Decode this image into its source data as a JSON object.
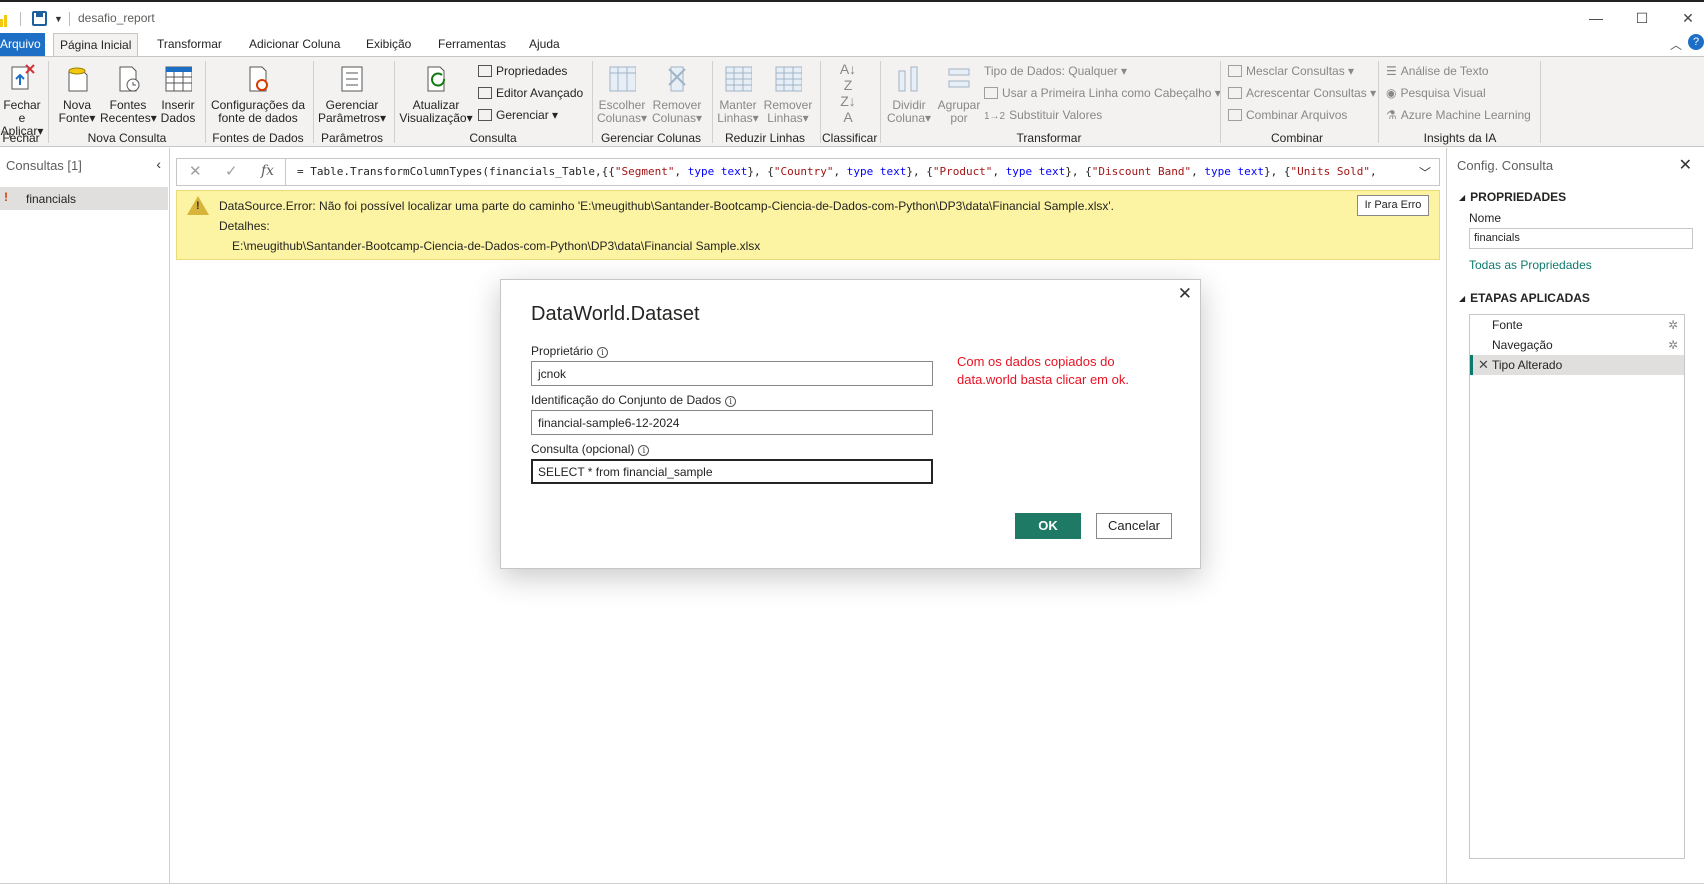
{
  "window": {
    "title": "desafio_report",
    "controls": [
      "minimize",
      "maximize",
      "close"
    ]
  },
  "tabs": [
    {
      "label": "Arquivo"
    },
    {
      "label": "Página Inicial"
    },
    {
      "label": "Transformar"
    },
    {
      "label": "Adicionar Coluna"
    },
    {
      "label": "Exibição"
    },
    {
      "label": "Ferramentas"
    },
    {
      "label": "Ajuda"
    }
  ],
  "ribbon": {
    "close_apply": {
      "l1": "Fechar e",
      "l2": "Aplicar"
    },
    "new_source": {
      "l1": "Nova",
      "l2": "Fonte"
    },
    "recent_sources": {
      "l1": "Fontes",
      "l2": "Recentes"
    },
    "enter_data": {
      "l1": "Inserir",
      "l2": "Dados"
    },
    "source_settings": {
      "l1": "Configurações da",
      "l2": "fonte de dados"
    },
    "manage_params": {
      "l1": "Gerenciar",
      "l2": "Parâmetros"
    },
    "refresh_preview": {
      "l1": "Atualizar",
      "l2": "Visualização"
    },
    "properties": "Propriedades",
    "advanced_editor": "Editor Avançado",
    "manage": "Gerenciar",
    "choose_columns": {
      "l1": "Escolher",
      "l2": "Colunas"
    },
    "remove_columns": {
      "l1": "Remover",
      "l2": "Colunas"
    },
    "keep_rows": {
      "l1": "Manter",
      "l2": "Linhas"
    },
    "remove_rows": {
      "l1": "Remover",
      "l2": "Linhas"
    },
    "split_column": {
      "l1": "Dividir",
      "l2": "Coluna"
    },
    "group_by": {
      "l1": "Agrupar",
      "l2": "por"
    },
    "data_type": "Tipo de Dados: Qualquer",
    "first_row_header": "Usar a Primeira Linha como Cabeçalho",
    "replace_values": "Substituir Valores",
    "merge_queries": "Mesclar Consultas",
    "append_queries": "Acrescentar Consultas",
    "combine_files": "Combinar Arquivos",
    "text_analytics": "Análise de Texto",
    "vision": "Pesquisa Visual",
    "azure_ml": "Azure Machine Learning",
    "groups": {
      "close": "Fechar",
      "new_query": "Nova Consulta",
      "data_sources": "Fontes de Dados",
      "parameters": "Parâmetros",
      "query": "Consulta",
      "manage_columns": "Gerenciar Colunas",
      "reduce_rows": "Reduzir Linhas",
      "sort": "Classificar",
      "transform": "Transformar",
      "combine": "Combinar",
      "ai_insights": "Insights da IA"
    }
  },
  "queries_pane": {
    "title": "Consultas [1]",
    "items": [
      {
        "name": "financials",
        "has_error": true
      }
    ]
  },
  "formula_bar": {
    "prefix": "= Table.TransformColumnTypes(financials_Table,{{",
    "s1": "\"Segment\"",
    "c1": ", ",
    "k1": "type text",
    "c2": "}, {",
    "s2": "\"Country\"",
    "c3": ", ",
    "k2": "type text",
    "c4": "}, {",
    "s3": "\"Product\"",
    "c5": ", ",
    "k3": "type text",
    "c6": "}, {",
    "s4": "\"Discount Band\"",
    "c7": ", ",
    "k4": "type text",
    "c8": "}, {",
    "s5": "\"Units Sold\"",
    "c9": ","
  },
  "error_banner": {
    "line1": "DataSource.Error: Não foi possível localizar uma parte do caminho 'E:\\meugithub\\Santander-Bootcamp-Ciencia-de-Dados-com-Python\\DP3\\data\\Financial Sample.xlsx'.",
    "line2": "Detalhes:",
    "line3": "E:\\meugithub\\Santander-Bootcamp-Ciencia-de-Dados-com-Python\\DP3\\data\\Financial Sample.xlsx",
    "button": "Ir Para Erro"
  },
  "settings_pane": {
    "title": "Config. Consulta",
    "properties_header": "PROPRIEDADES",
    "name_label": "Nome",
    "name_value": "financials",
    "all_properties": "Todas as Propriedades",
    "steps_header": "ETAPAS APLICADAS",
    "steps": [
      {
        "label": "Fonte"
      },
      {
        "label": "Navegação"
      },
      {
        "label": "Tipo Alterado"
      }
    ]
  },
  "dialog": {
    "title": "DataWorld.Dataset",
    "owner_label": "Proprietário",
    "owner_value": "jcnok",
    "dataset_label": "Identificação do Conjunto de Dados",
    "dataset_value": "financial-sample6-12-2024",
    "query_label": "Consulta (opcional)",
    "query_value": "SELECT * from financial_sample",
    "note": "Com os dados copiados do data.world basta clicar em ok.",
    "ok": "OK",
    "cancel": "Cancelar"
  },
  "colors": {
    "accent": "#1d6fc5",
    "ok_button": "#1f7a65",
    "error_banner": "#fcf4a3",
    "note_text": "#e81123",
    "link": "#0e7a6d"
  }
}
